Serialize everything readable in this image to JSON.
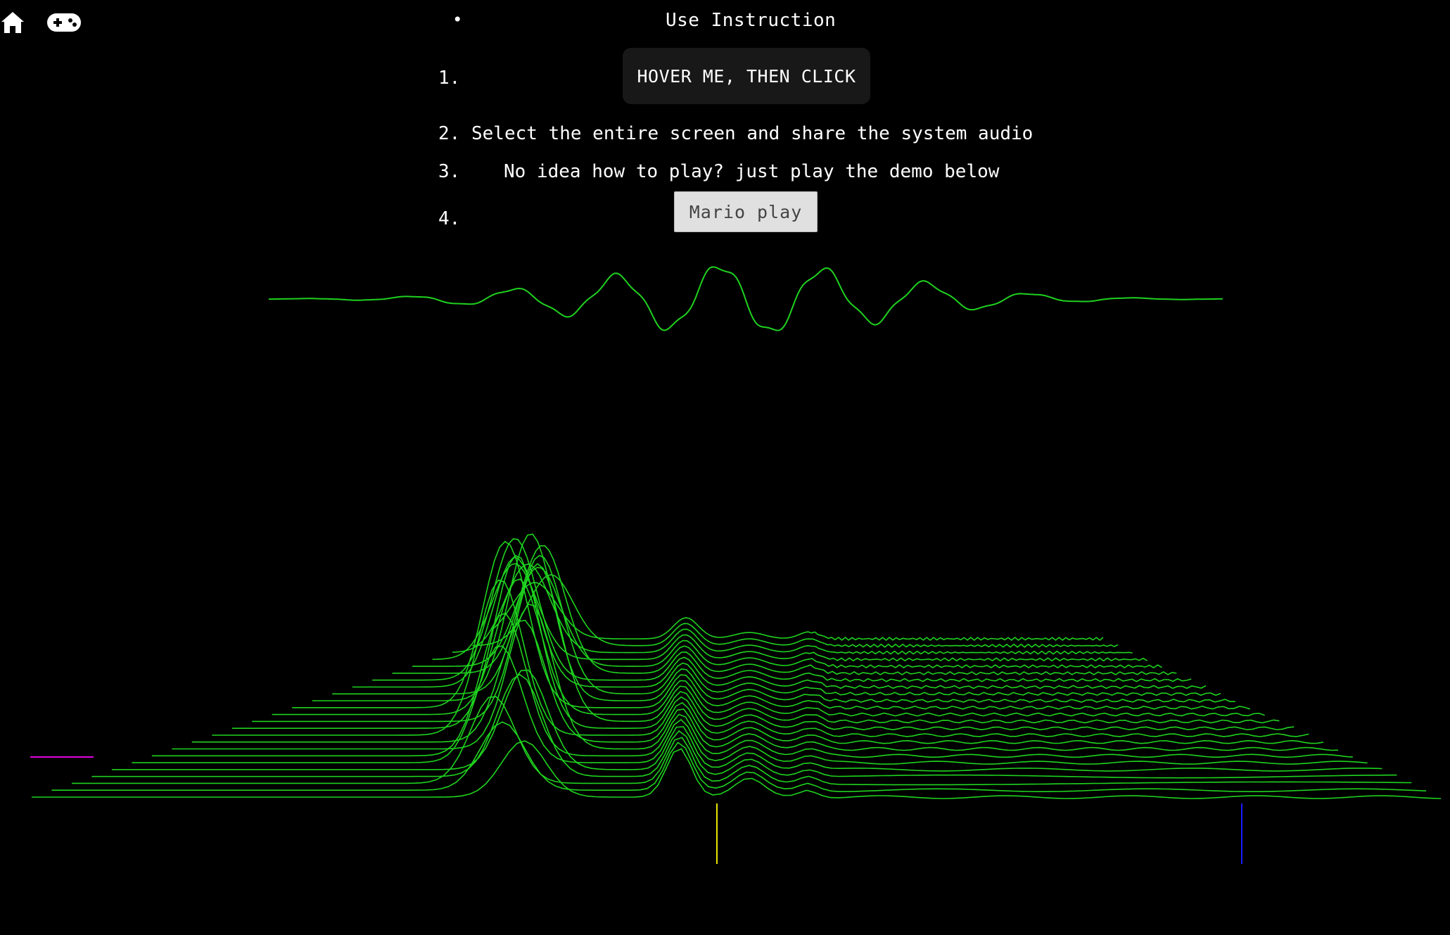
{
  "toolbar": {
    "home_icon": "home-icon",
    "game_icon": "gamepad-icon",
    "icon_color": "#ffffff"
  },
  "instructions": {
    "bullet": "•",
    "title": "Use Instruction",
    "steps": [
      {
        "num": "1.",
        "button_label": "HOVER ME, THEN CLICK"
      },
      {
        "num": "2.",
        "text": "Select the entire screen and share the system audio"
      },
      {
        "num": "3.",
        "text": "No idea how to play? just play the demo below"
      },
      {
        "num": "4.",
        "button_label": "Mario play"
      }
    ]
  },
  "visualizer": {
    "waveform_color": "#1fd21f",
    "spectrum_color": "#1fd21f",
    "marker_colors": {
      "left": "#e000e0",
      "center": "#e6e600",
      "right": "#1a1aff"
    }
  }
}
